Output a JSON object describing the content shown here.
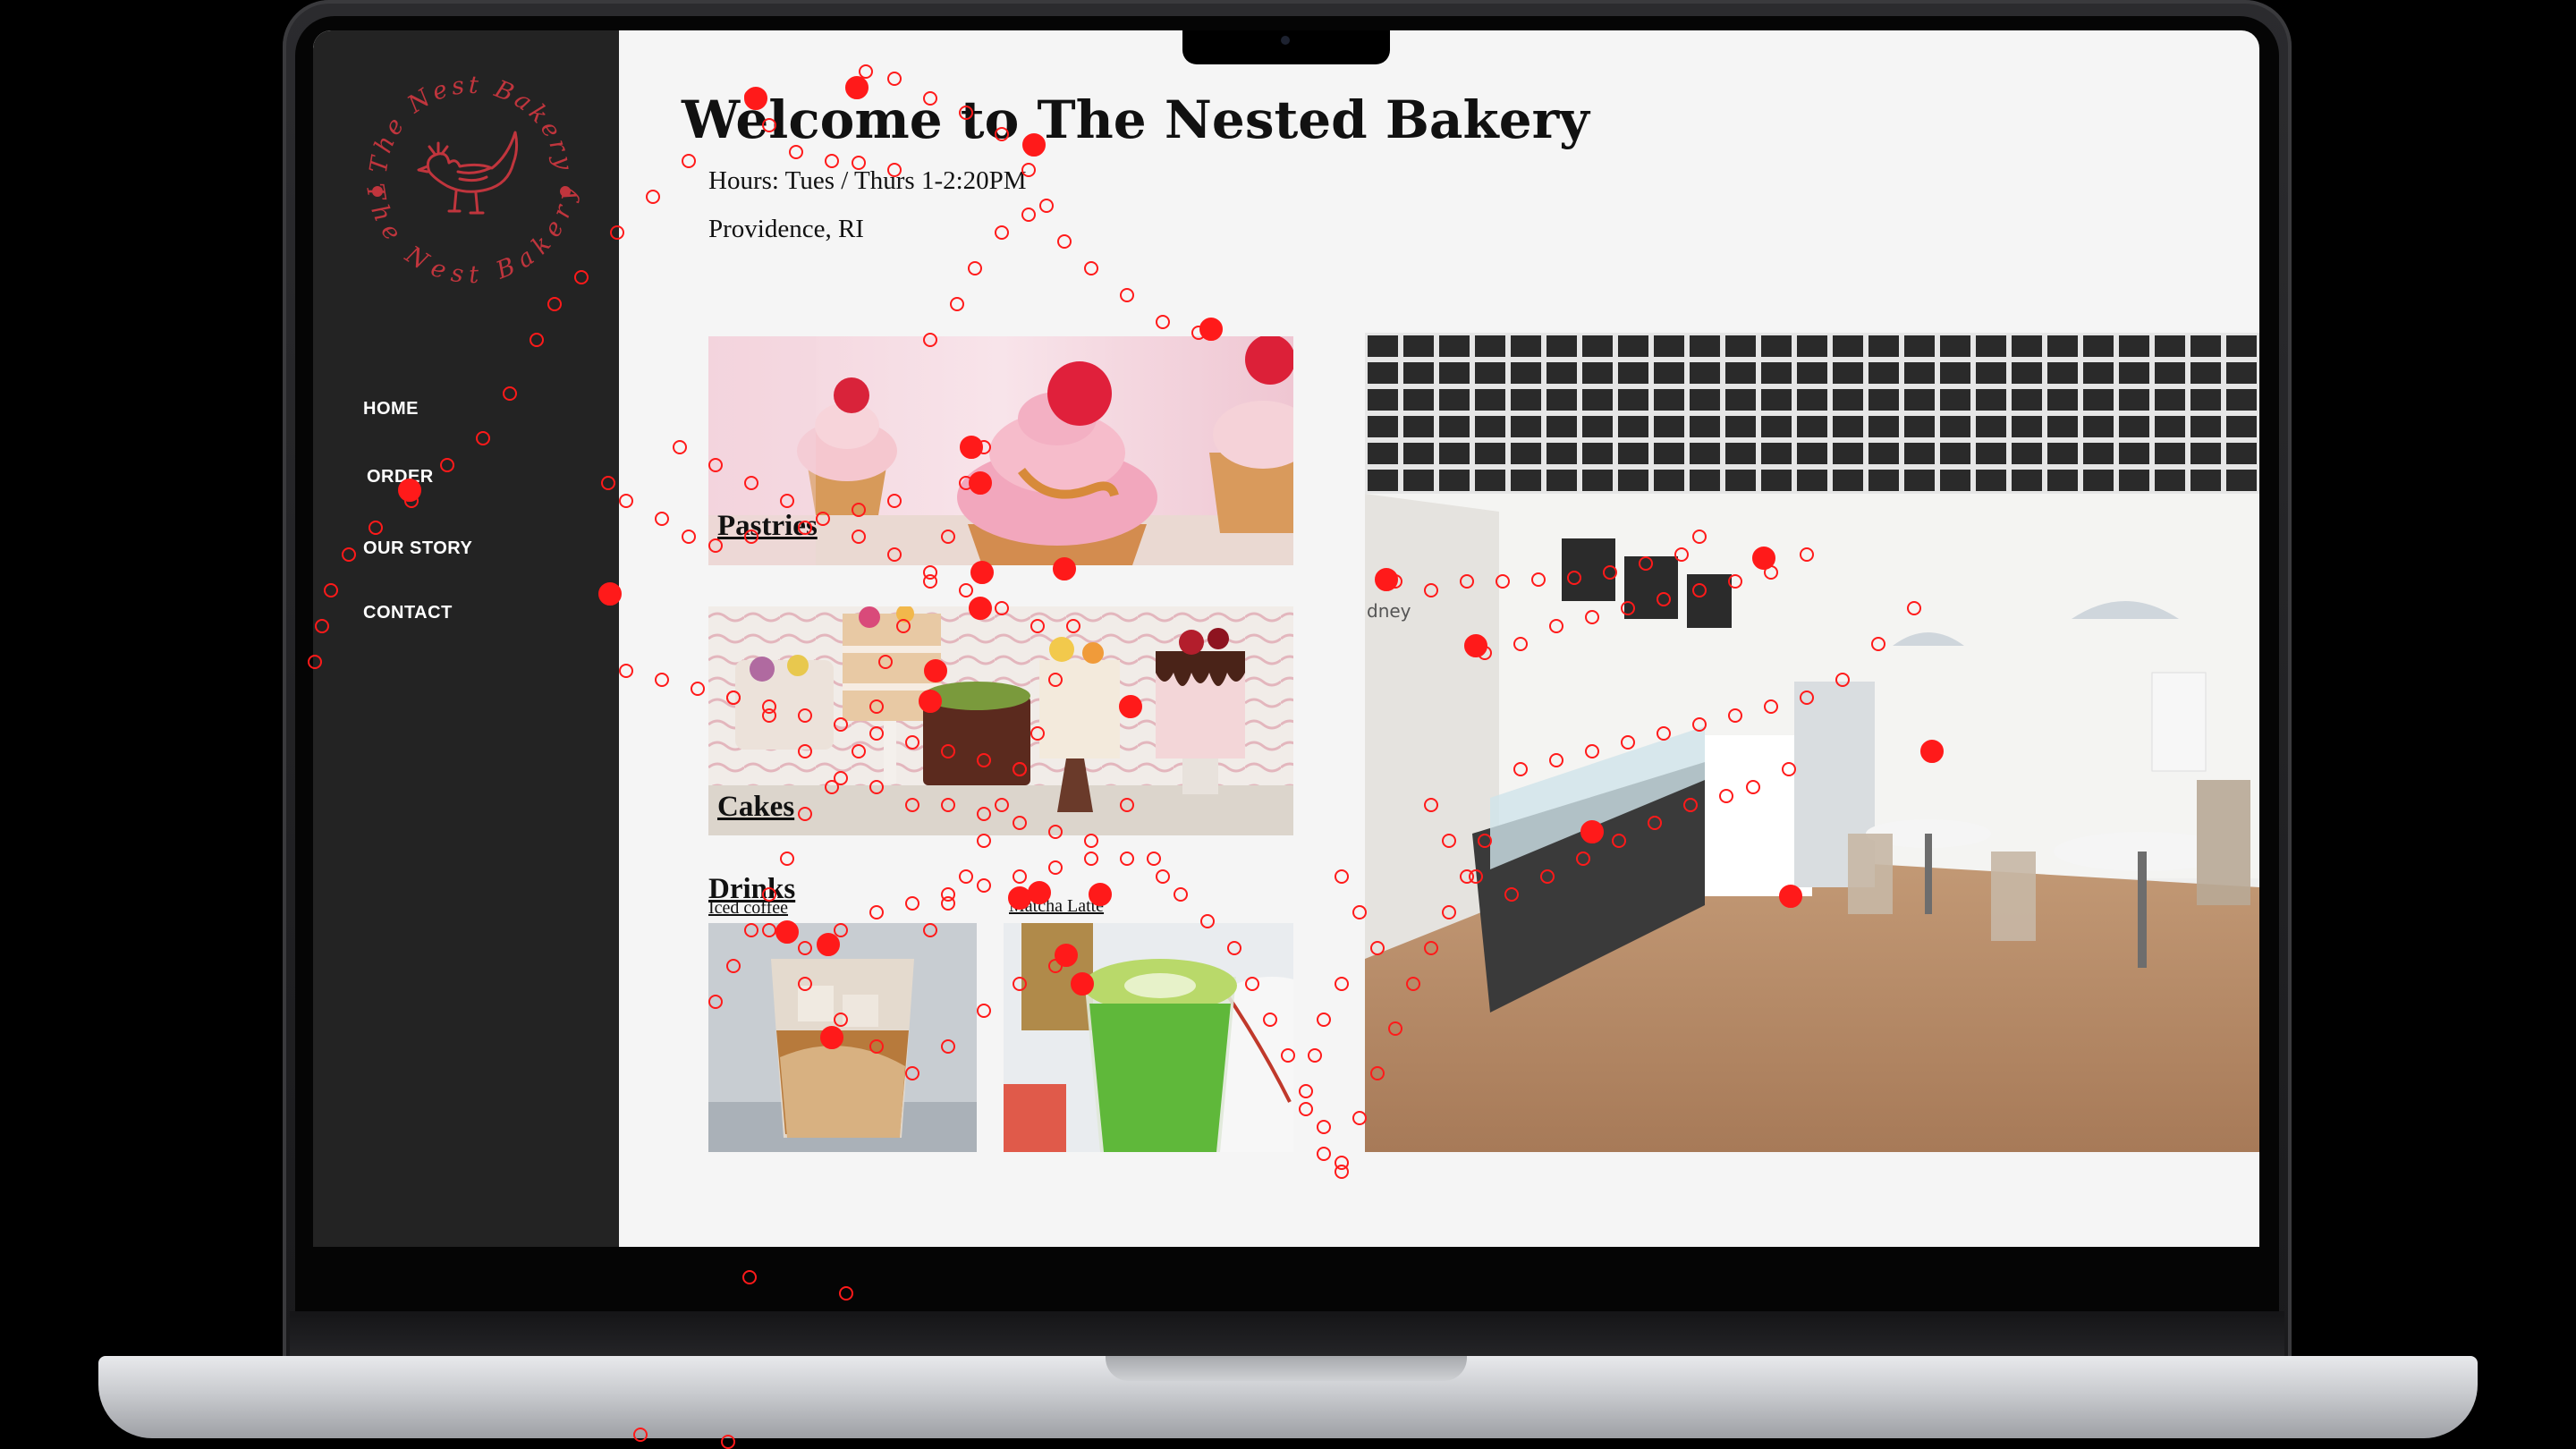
{
  "logo": {
    "arc_text_top": "The Nest Bakery",
    "arc_text_bottom": "The Nest Bakery",
    "color": "#c0353d",
    "icon": "hen-icon"
  },
  "nav": {
    "items": [
      {
        "label": "HOME"
      },
      {
        "label": "ORDER"
      },
      {
        "label": "OUR STORY"
      },
      {
        "label": "CONTACT"
      }
    ]
  },
  "main": {
    "title": "Welcome to The Nested Bakery",
    "hours": "Hours: Tues / Thurs 1-2:20PM",
    "location": "Providence, RI",
    "categories": [
      {
        "label": "Pastries"
      },
      {
        "label": "Cakes"
      },
      {
        "label": "Drinks"
      }
    ],
    "drinks": [
      {
        "caption": "Iced coffee"
      },
      {
        "caption": "Matcha Latte"
      }
    ],
    "storefront_sign": "dney"
  },
  "colors": {
    "sidebar": "#232323",
    "page_background": "#f5f5f5",
    "gaze_marker": "#ff1a1a"
  }
}
